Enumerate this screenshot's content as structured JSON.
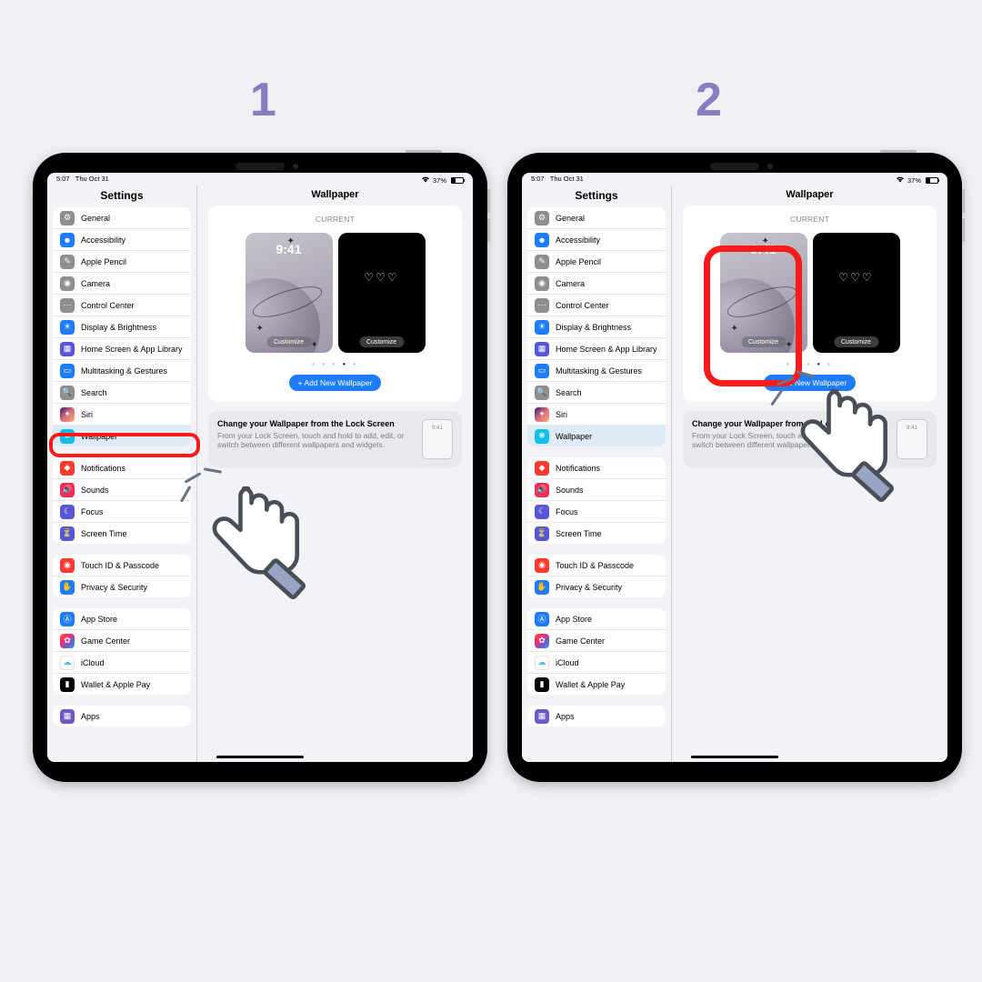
{
  "steps": {
    "one": "1",
    "two": "2"
  },
  "status": {
    "time": "5:07",
    "date": "Thu Oct 31",
    "battery_pct": "37%"
  },
  "sidebar": {
    "title": "Settings",
    "g1": {
      "general": "General",
      "accessibility": "Accessibility",
      "pencil": "Apple Pencil",
      "camera": "Camera",
      "control": "Control Center",
      "display": "Display & Brightness",
      "home": "Home Screen & App Library",
      "multi": "Multitasking & Gestures",
      "search": "Search",
      "siri": "Siri",
      "wallpaper": "Wallpaper"
    },
    "g2": {
      "notif": "Notifications",
      "sounds": "Sounds",
      "focus": "Focus",
      "screentime": "Screen Time"
    },
    "g3": {
      "touchid": "Touch ID & Passcode",
      "privacy": "Privacy & Security"
    },
    "g4": {
      "appstore": "App Store",
      "gamecenter": "Game Center",
      "icloud": "iCloud",
      "wallet": "Wallet & Apple Pay"
    },
    "g5": {
      "apps": "Apps"
    }
  },
  "content": {
    "title": "Wallpaper",
    "current": "CURRENT",
    "preview_time": "9:41",
    "hearts": "♡♡♡",
    "customize": "Customize",
    "add": "+ Add New Wallpaper",
    "tip_title": "Change your Wallpaper from the Lock Screen",
    "tip_body": "From your Lock Screen, touch and hold to add, edit, or switch between different wallpapers and widgets.",
    "tip_thumb_time": "9:41"
  },
  "colors": {
    "gray": "#8e8e93",
    "blue": "#1e7cff",
    "lblue": "#2aa6ff",
    "orange": "#ff9500",
    "red": "#ff3b30",
    "green": "#34c759",
    "purple": "#6f58c6",
    "indigo": "#5856d6",
    "dark": "#3a3a3c",
    "cyan": "#10beea",
    "pink": "#ff2d55",
    "gradient": "multi"
  }
}
